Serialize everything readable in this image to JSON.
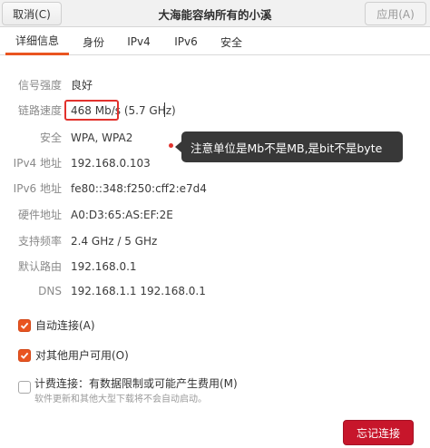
{
  "header": {
    "title": "大海能容纳所有的小溪",
    "cancel_label": "取消(C)",
    "apply_label": "应用(A)"
  },
  "tabs": [
    {
      "label": "详细信息",
      "active": true
    },
    {
      "label": "身份",
      "active": false
    },
    {
      "label": "IPv4",
      "active": false
    },
    {
      "label": "IPv6",
      "active": false
    },
    {
      "label": "安全",
      "active": false
    }
  ],
  "details": {
    "signal_label": "信号强度",
    "signal_value": "良好",
    "speed_label": "链路速度",
    "speed_value": "468 Mb/s",
    "speed_freq": "(5.7 GHz)",
    "security_label": "安全",
    "security_value": "WPA, WPA2",
    "ipv4_label": "IPv4 地址",
    "ipv4_value": "192.168.0.103",
    "ipv6_label": "IPv6 地址",
    "ipv6_value": "fe80::348:f250:cff2:e7d4",
    "mac_label": "硬件地址",
    "mac_value": "A0:D3:65:AS:EF:2E",
    "freq_label": "支持频率",
    "freq_value": "2.4 GHz / 5 GHz",
    "route_label": "默认路由",
    "route_value": "192.168.0.1",
    "dns_label": "DNS",
    "dns_value": "192.168.1.1 192.168.0.1"
  },
  "annotation": {
    "tooltip_text": "注意单位是Mb不是MB,是bit不是byte",
    "highlight_color": "#e2322d"
  },
  "options": {
    "auto_connect_label": "自动连接(A)",
    "auto_connect": true,
    "all_users_label": "对其他用户可用(O)",
    "all_users": true,
    "metered_label": "计费连接：有数据限制或可能产生费用(M)",
    "metered": false,
    "metered_hint": "软件更新和其他大型下载将不会自动启动。"
  },
  "footer": {
    "forget_label": "忘记连接",
    "forget_color": "#c7162b"
  },
  "colors": {
    "accent": "#e95420"
  }
}
